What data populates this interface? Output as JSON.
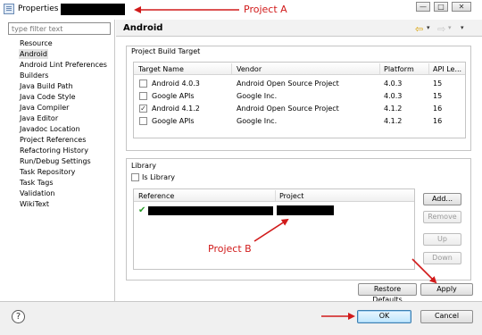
{
  "window": {
    "title": "Properties for",
    "minimize_glyph": "—",
    "maximize_glyph": "□",
    "close_glyph": "✕"
  },
  "left_panel": {
    "filter_placeholder": "type filter text",
    "items": [
      {
        "label": "Resource"
      },
      {
        "label": "Android",
        "selected": true
      },
      {
        "label": "Android Lint Preferences"
      },
      {
        "label": "Builders"
      },
      {
        "label": "Java Build Path"
      },
      {
        "label": "Java Code Style"
      },
      {
        "label": "Java Compiler"
      },
      {
        "label": "Java Editor"
      },
      {
        "label": "Javadoc Location"
      },
      {
        "label": "Project References"
      },
      {
        "label": "Refactoring History"
      },
      {
        "label": "Run/Debug Settings"
      },
      {
        "label": "Task Repository"
      },
      {
        "label": "Task Tags"
      },
      {
        "label": "Validation"
      },
      {
        "label": "WikiText"
      }
    ]
  },
  "header": {
    "title": "Android",
    "back_icon": "⇦",
    "forward_icon": "⇨",
    "dropdown_glyph": "▾"
  },
  "build_target": {
    "title": "Project Build Target",
    "columns": [
      "Target Name",
      "Vendor",
      "Platform",
      "API Le..."
    ],
    "rows": [
      {
        "checked": false,
        "name": "Android 4.0.3",
        "vendor": "Android Open Source Project",
        "platform": "4.0.3",
        "api": "15"
      },
      {
        "checked": false,
        "name": "Google APIs",
        "vendor": "Google Inc.",
        "platform": "4.0.3",
        "api": "15"
      },
      {
        "checked": true,
        "name": "Android 4.1.2",
        "vendor": "Android Open Source Project",
        "platform": "4.1.2",
        "api": "16"
      },
      {
        "checked": false,
        "name": "Google APIs",
        "vendor": "Google Inc.",
        "platform": "4.1.2",
        "api": "16"
      }
    ]
  },
  "library": {
    "title": "Library",
    "is_library_label": "Is Library",
    "is_library_checked": false,
    "columns": [
      "Reference",
      "Project"
    ],
    "buttons": {
      "add": "Add...",
      "remove": "Remove",
      "up": "Up",
      "down": "Down"
    }
  },
  "actions": {
    "restore_defaults": "Restore Defaults",
    "apply": "Apply",
    "ok": "OK",
    "cancel": "Cancel",
    "help_glyph": "?"
  },
  "annotations": {
    "project_a": "Project A",
    "project_b": "Project B",
    "color": "#d11a1a"
  }
}
